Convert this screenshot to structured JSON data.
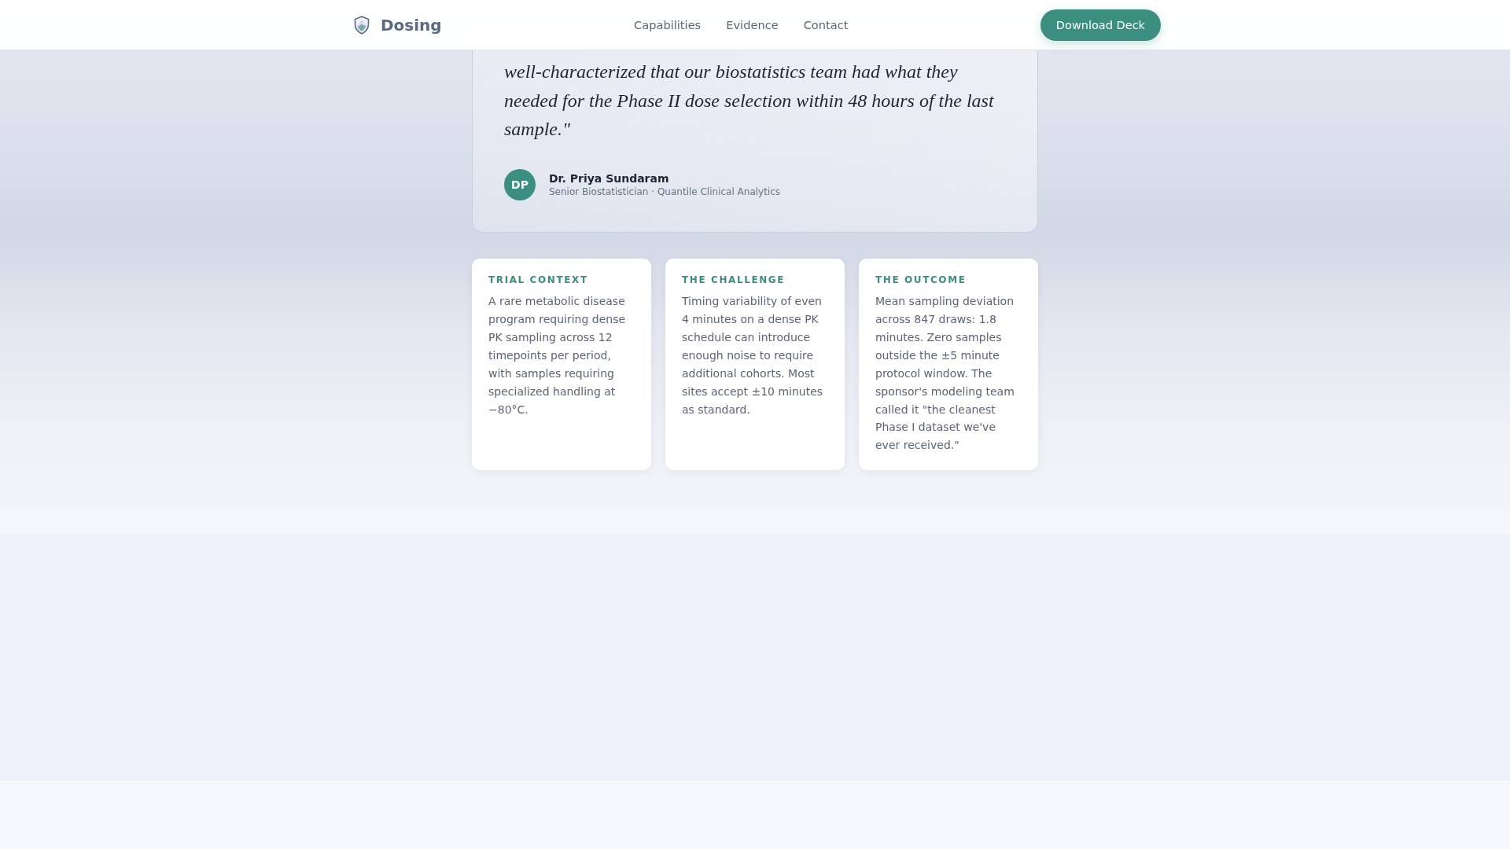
{
  "header": {
    "brand": "Dosing",
    "nav": [
      "Capabilities",
      "Evidence",
      "Contact"
    ],
    "cta": "Download Deck"
  },
  "testimonial": {
    "quote": "well-characterized that our biostatistics team had what they needed for the Phase II dose selection within 48 hours of the last sample.\"",
    "avatar_initials": "DP",
    "name": "Dr. Priya Sundaram",
    "role": "Senior Biostatistician · Quantile Clinical Analytics"
  },
  "cards": [
    {
      "heading": "TRIAL CONTEXT",
      "body": "A rare metabolic disease program requiring dense PK sampling across 12 timepoints per period, with samples requiring specialized handling at −80°C."
    },
    {
      "heading": "THE CHALLENGE",
      "body": "Timing variability of even 4 minutes on a dense PK schedule can introduce enough noise to require additional cohorts. Most sites accept ±10 minutes as standard."
    },
    {
      "heading": "THE OUTCOME",
      "body": "Mean sampling deviation across 847 draws: 1.8 minutes. Zero samples outside the ±5 minute protocol window. The sponsor's modeling team called it \"the cleanest Phase I dataset we've ever received.\""
    }
  ]
}
